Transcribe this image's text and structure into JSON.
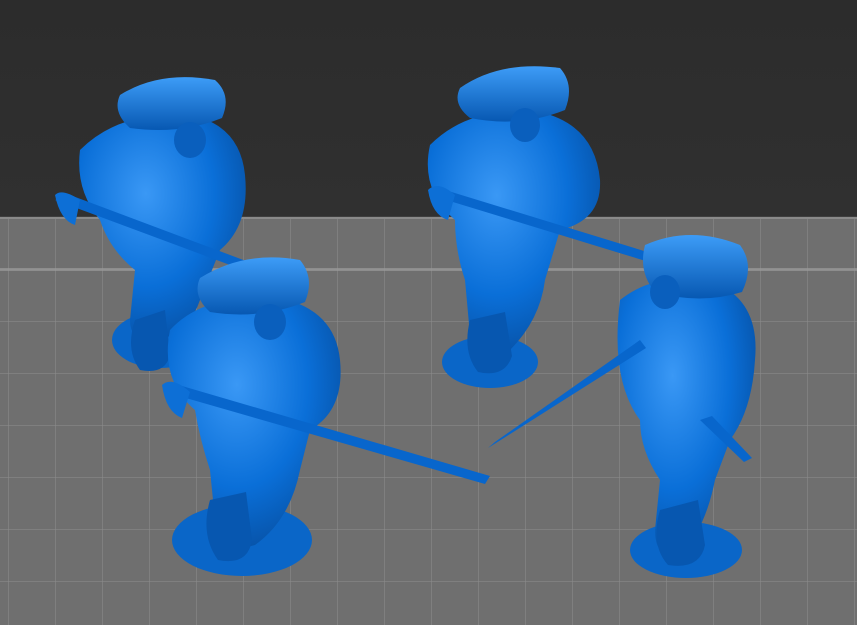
{
  "viewer": {
    "background_color": "#2e2e2e",
    "plate_color": "#6f6f6f",
    "grid_color": "#8c8c8c",
    "model_color": "#0a6fd8",
    "model_shadow_color": "#064a99"
  },
  "models": [
    {
      "name": "soldier-figure"
    },
    {
      "name": "soldier-figure"
    },
    {
      "name": "soldier-figure"
    },
    {
      "name": "soldier-figure"
    }
  ]
}
